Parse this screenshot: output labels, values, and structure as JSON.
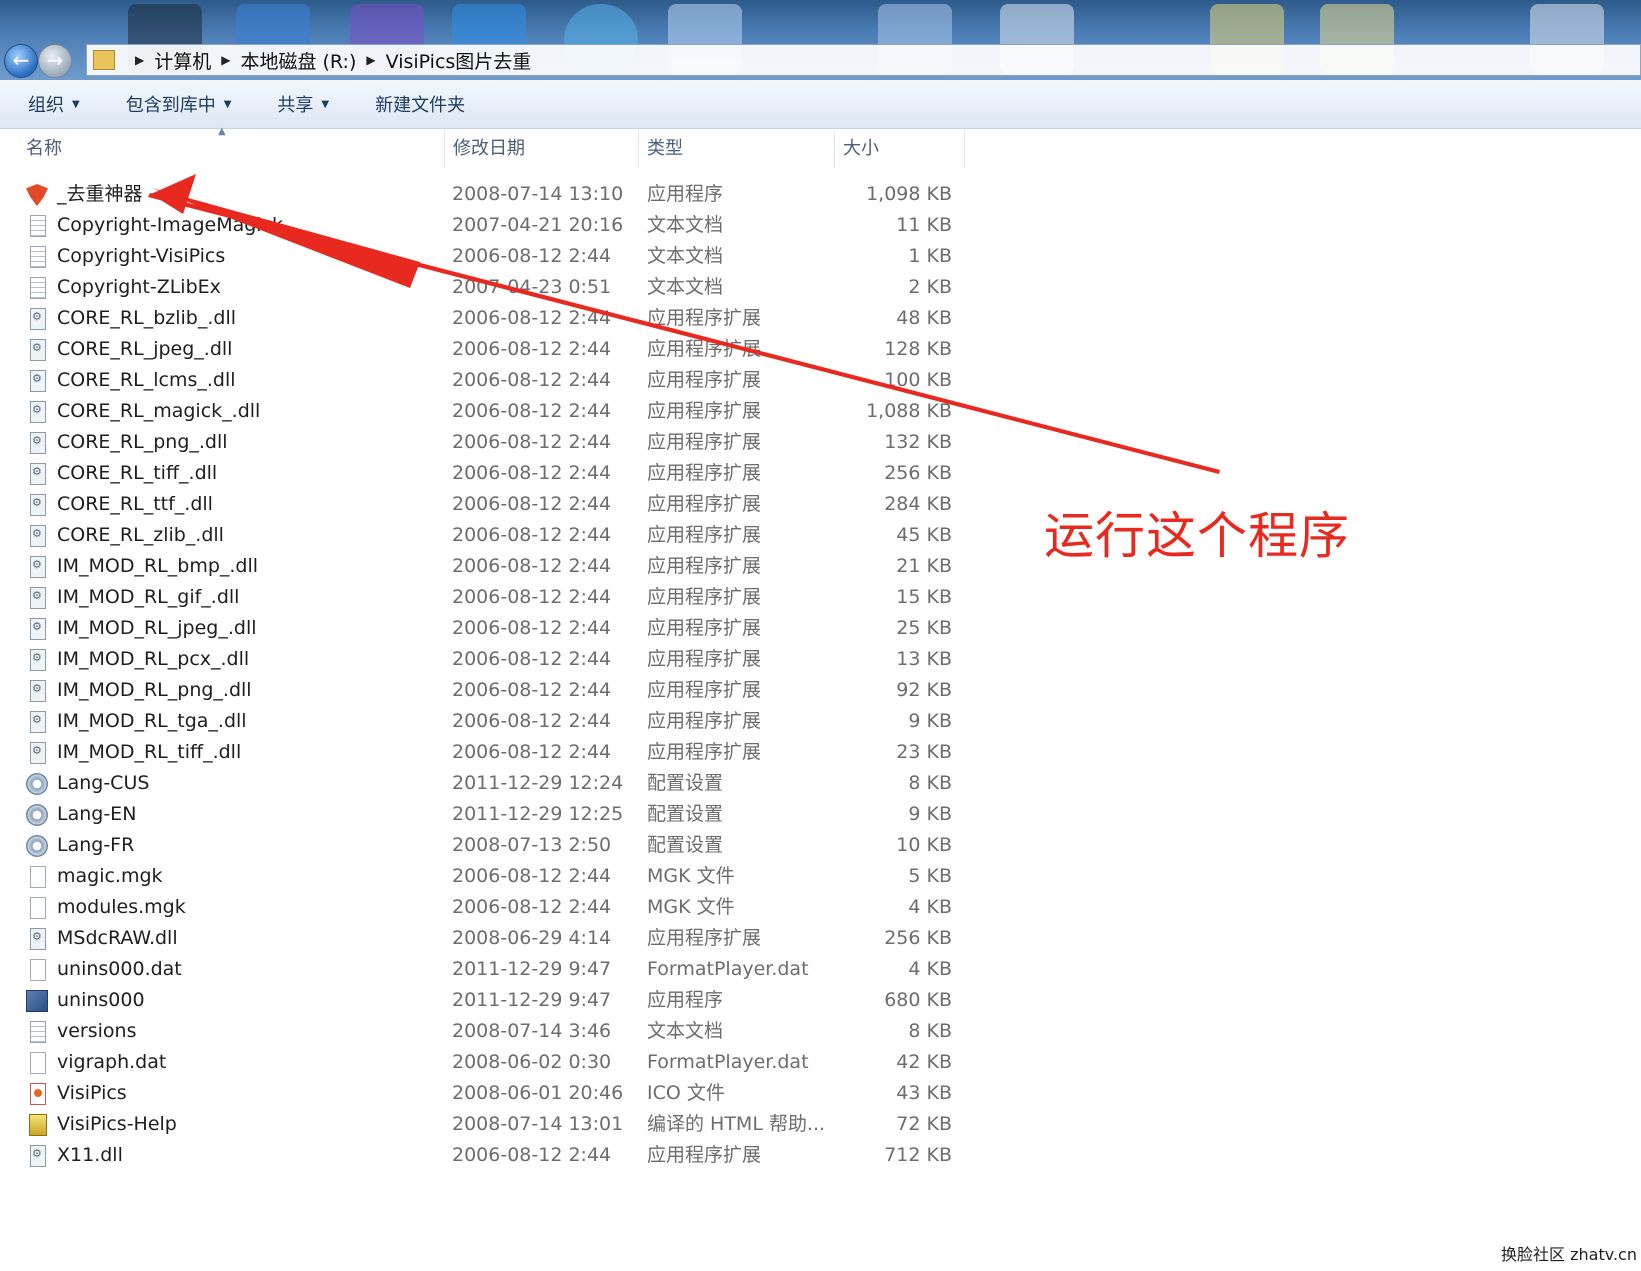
{
  "address_bar": {
    "crumbs": [
      "计算机",
      "本地磁盘 (R:)",
      "VisiPics图片去重"
    ]
  },
  "toolbar": {
    "organize": "组织",
    "include_library": "包含到库中",
    "share": "共享",
    "new_folder": "新建文件夹"
  },
  "columns": {
    "name": "名称",
    "date": "修改日期",
    "type": "类型",
    "size": "大小"
  },
  "files": [
    {
      "name": "_去重神器",
      "date": "2008-07-14 13:10",
      "type": "应用程序",
      "size": "1,098 KB",
      "icon": "fox-app-icon"
    },
    {
      "name": "Copyright-ImageMagick",
      "date": "2007-04-21 20:16",
      "type": "文本文档",
      "size": "11 KB",
      "icon": "text-file-icon"
    },
    {
      "name": "Copyright-VisiPics",
      "date": "2006-08-12 2:44",
      "type": "文本文档",
      "size": "1 KB",
      "icon": "text-file-icon"
    },
    {
      "name": "Copyright-ZLibEx",
      "date": "2007-04-23 0:51",
      "type": "文本文档",
      "size": "2 KB",
      "icon": "text-file-icon"
    },
    {
      "name": "CORE_RL_bzlib_.dll",
      "date": "2006-08-12 2:44",
      "type": "应用程序扩展",
      "size": "48 KB",
      "icon": "dll-file-icon"
    },
    {
      "name": "CORE_RL_jpeg_.dll",
      "date": "2006-08-12 2:44",
      "type": "应用程序扩展",
      "size": "128 KB",
      "icon": "dll-file-icon"
    },
    {
      "name": "CORE_RL_lcms_.dll",
      "date": "2006-08-12 2:44",
      "type": "应用程序扩展",
      "size": "100 KB",
      "icon": "dll-file-icon"
    },
    {
      "name": "CORE_RL_magick_.dll",
      "date": "2006-08-12 2:44",
      "type": "应用程序扩展",
      "size": "1,088 KB",
      "icon": "dll-file-icon"
    },
    {
      "name": "CORE_RL_png_.dll",
      "date": "2006-08-12 2:44",
      "type": "应用程序扩展",
      "size": "132 KB",
      "icon": "dll-file-icon"
    },
    {
      "name": "CORE_RL_tiff_.dll",
      "date": "2006-08-12 2:44",
      "type": "应用程序扩展",
      "size": "256 KB",
      "icon": "dll-file-icon"
    },
    {
      "name": "CORE_RL_ttf_.dll",
      "date": "2006-08-12 2:44",
      "type": "应用程序扩展",
      "size": "284 KB",
      "icon": "dll-file-icon"
    },
    {
      "name": "CORE_RL_zlib_.dll",
      "date": "2006-08-12 2:44",
      "type": "应用程序扩展",
      "size": "45 KB",
      "icon": "dll-file-icon"
    },
    {
      "name": "IM_MOD_RL_bmp_.dll",
      "date": "2006-08-12 2:44",
      "type": "应用程序扩展",
      "size": "21 KB",
      "icon": "dll-file-icon"
    },
    {
      "name": "IM_MOD_RL_gif_.dll",
      "date": "2006-08-12 2:44",
      "type": "应用程序扩展",
      "size": "15 KB",
      "icon": "dll-file-icon"
    },
    {
      "name": "IM_MOD_RL_jpeg_.dll",
      "date": "2006-08-12 2:44",
      "type": "应用程序扩展",
      "size": "25 KB",
      "icon": "dll-file-icon"
    },
    {
      "name": "IM_MOD_RL_pcx_.dll",
      "date": "2006-08-12 2:44",
      "type": "应用程序扩展",
      "size": "13 KB",
      "icon": "dll-file-icon"
    },
    {
      "name": "IM_MOD_RL_png_.dll",
      "date": "2006-08-12 2:44",
      "type": "应用程序扩展",
      "size": "92 KB",
      "icon": "dll-file-icon"
    },
    {
      "name": "IM_MOD_RL_tga_.dll",
      "date": "2006-08-12 2:44",
      "type": "应用程序扩展",
      "size": "9 KB",
      "icon": "dll-file-icon"
    },
    {
      "name": "IM_MOD_RL_tiff_.dll",
      "date": "2006-08-12 2:44",
      "type": "应用程序扩展",
      "size": "23 KB",
      "icon": "dll-file-icon"
    },
    {
      "name": "Lang-CUS",
      "date": "2011-12-29 12:24",
      "type": "配置设置",
      "size": "8 KB",
      "icon": "config-file-icon"
    },
    {
      "name": "Lang-EN",
      "date": "2011-12-29 12:25",
      "type": "配置设置",
      "size": "9 KB",
      "icon": "config-file-icon"
    },
    {
      "name": "Lang-FR",
      "date": "2008-07-13 2:50",
      "type": "配置设置",
      "size": "10 KB",
      "icon": "config-file-icon"
    },
    {
      "name": "magic.mgk",
      "date": "2006-08-12 2:44",
      "type": "MGK 文件",
      "size": "5 KB",
      "icon": "blank-file-icon"
    },
    {
      "name": "modules.mgk",
      "date": "2006-08-12 2:44",
      "type": "MGK 文件",
      "size": "4 KB",
      "icon": "blank-file-icon"
    },
    {
      "name": "MSdcRAW.dll",
      "date": "2008-06-29 4:14",
      "type": "应用程序扩展",
      "size": "256 KB",
      "icon": "dll-file-icon"
    },
    {
      "name": "unins000.dat",
      "date": "2011-12-29 9:47",
      "type": "FormatPlayer.dat",
      "size": "4 KB",
      "icon": "blank-file-icon"
    },
    {
      "name": "unins000",
      "date": "2011-12-29 9:47",
      "type": "应用程序",
      "size": "680 KB",
      "icon": "setup-app-icon"
    },
    {
      "name": "versions",
      "date": "2008-07-14 3:46",
      "type": "文本文档",
      "size": "8 KB",
      "icon": "text-file-icon"
    },
    {
      "name": "vigraph.dat",
      "date": "2008-06-02 0:30",
      "type": "FormatPlayer.dat",
      "size": "42 KB",
      "icon": "blank-file-icon"
    },
    {
      "name": "VisiPics",
      "date": "2008-06-01 20:46",
      "type": "ICO 文件",
      "size": "43 KB",
      "icon": "ico-file-icon"
    },
    {
      "name": "VisiPics-Help",
      "date": "2008-07-14 13:01",
      "type": "编译的 HTML 帮助...",
      "size": "72 KB",
      "icon": "chm-help-icon"
    },
    {
      "name": "X11.dll",
      "date": "2006-08-12 2:44",
      "type": "应用程序扩展",
      "size": "712 KB",
      "icon": "dll-file-icon"
    }
  ],
  "annotation": {
    "text": "运行这个程序",
    "color": "#e8291f"
  },
  "watermark": "换脸社区 zhatv.cn"
}
